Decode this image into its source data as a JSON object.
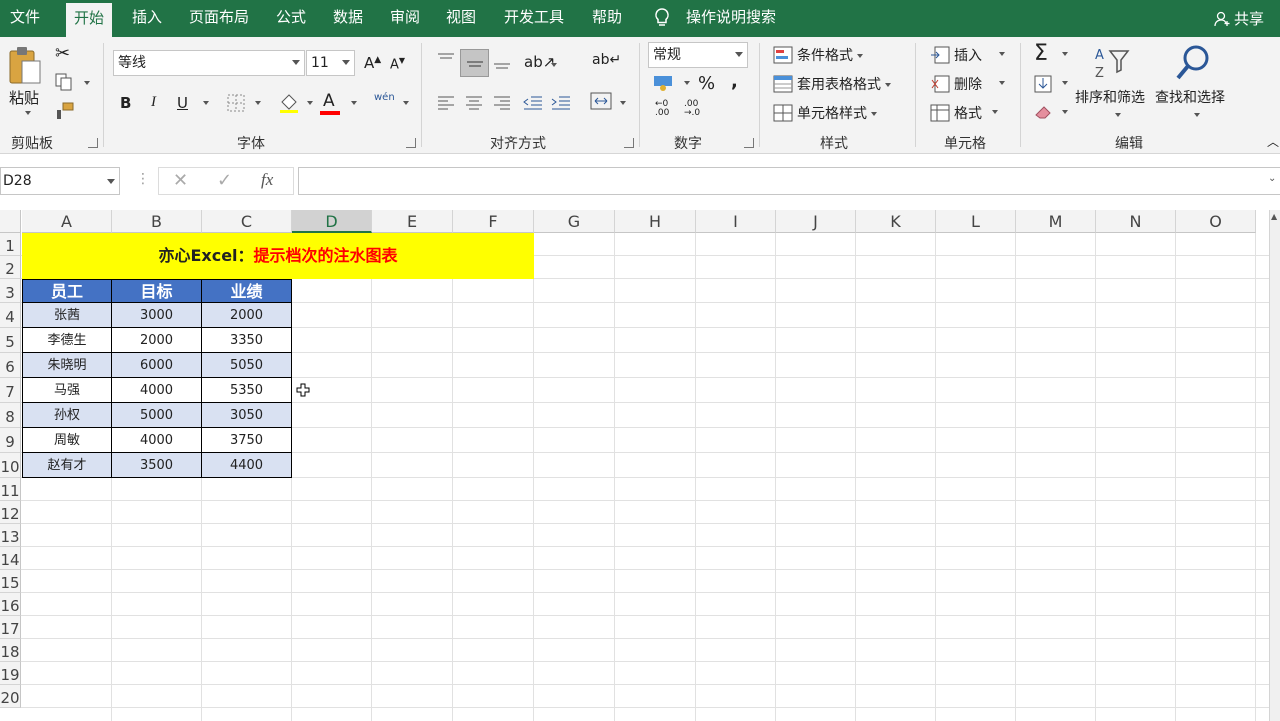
{
  "tabs": [
    "文件",
    "开始",
    "插入",
    "页面布局",
    "公式",
    "数据",
    "审阅",
    "视图",
    "开发工具",
    "帮助"
  ],
  "active_tab": "开始",
  "search_label": "操作说明搜索",
  "share_label": "共享",
  "clipboard": {
    "paste": "粘贴",
    "group": "剪贴板"
  },
  "font": {
    "name": "等线",
    "size": "11",
    "group": "字体",
    "bold": "B",
    "italic": "I",
    "underline": "U",
    "font_color_letter": "A",
    "phonetic": "wén"
  },
  "alignment": {
    "group": "对齐方式"
  },
  "number": {
    "format": "常规",
    "group": "数字",
    "percent": "%",
    "comma": ","
  },
  "styles": {
    "conditional": "条件格式",
    "table": "套用表格格式",
    "cell": "单元格样式",
    "group": "样式"
  },
  "cells": {
    "insert": "插入",
    "delete": "删除",
    "format": "格式",
    "group": "单元格"
  },
  "editing": {
    "sort": "排序和筛选",
    "find": "查找和选择",
    "group": "编辑"
  },
  "namebox": "D28",
  "fx": "fx",
  "columns": [
    "A",
    "B",
    "C",
    "D",
    "E",
    "F",
    "G",
    "H",
    "I",
    "J",
    "K",
    "L",
    "M",
    "N",
    "O"
  ],
  "selected_column": "D",
  "rows": [
    "1",
    "2",
    "3",
    "4",
    "5",
    "6",
    "7",
    "8",
    "9",
    "10",
    "11",
    "12",
    "13",
    "14",
    "15",
    "16",
    "17",
    "18",
    "19",
    "20"
  ],
  "title": {
    "black": "亦心Excel：",
    "red": "提示档次的注水图表"
  },
  "table": {
    "headers": [
      "员工",
      "目标",
      "业绩"
    ],
    "rows": [
      [
        "张茜",
        "3000",
        "2000"
      ],
      [
        "李德生",
        "2000",
        "3350"
      ],
      [
        "朱晓明",
        "6000",
        "5050"
      ],
      [
        "马强",
        "4000",
        "5350"
      ],
      [
        "孙权",
        "5000",
        "3050"
      ],
      [
        "周敏",
        "4000",
        "3750"
      ],
      [
        "赵有才",
        "3500",
        "4400"
      ]
    ]
  },
  "colors": {
    "ribbon_green": "#217346",
    "header_blue": "#4472c4",
    "band_blue": "#d9e1f2",
    "title_yellow": "#ffff00",
    "title_red": "#ff0000"
  }
}
